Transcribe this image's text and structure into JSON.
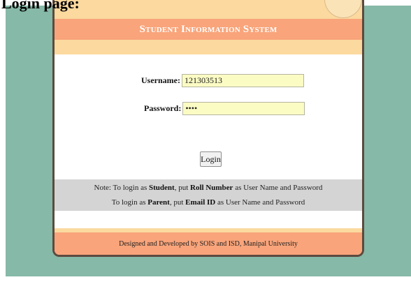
{
  "heading": "Login page:",
  "app": {
    "title": "Student Information System"
  },
  "form": {
    "username_label": "Username:",
    "username_value": "121303513",
    "password_label": "Password:",
    "password_value": "••••",
    "login_button": "Login"
  },
  "note": {
    "line1": {
      "prefix": "Note: To login as ",
      "role": "Student",
      "middle": ", put ",
      "field": "Roll Number",
      "suffix": " as User Name and Password"
    },
    "line2": {
      "prefix": "To login as ",
      "role": "Parent",
      "middle": ", put ",
      "field": "Email ID",
      "suffix": " as User Name and Password"
    }
  },
  "footer": {
    "text": "Designed and Developed by SOIS and ISD, Manipal University"
  },
  "colors": {
    "page_background": "#86b9a7",
    "title_bar": "#f9a47a",
    "accent_strip": "#fbd99f",
    "input_background": "#fbfbc4",
    "note_band": "#d4d4d4"
  },
  "icons": {
    "logo": "university-seal-icon"
  }
}
